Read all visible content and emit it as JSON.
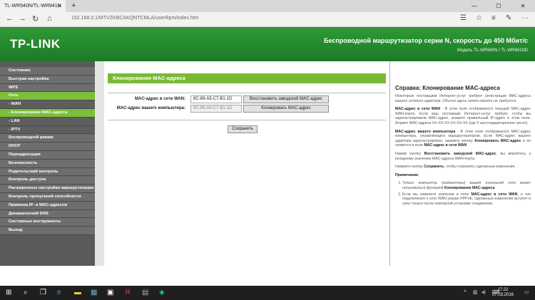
{
  "browser": {
    "tab_title": "TL-WR940N/TL-WR941N",
    "tab_close": "✕",
    "new_tab": "+",
    "url": "192.168.0.1/MTVZKBCAKQNTCMLA/userRpm/index.htm",
    "window_controls": [
      "—",
      "☐",
      "✕"
    ]
  },
  "router": {
    "logo": "TP-LINK",
    "title": "Беспроводной маршрутизатор серии N, скорость до 450 Мбит/с",
    "model": "Модель TL-WR940N / TL-WR941ND"
  },
  "menu": [
    {
      "label": "Состояние"
    },
    {
      "label": "Быстрая настройка"
    },
    {
      "label": "WPS"
    },
    {
      "label": "Сеть",
      "active": true
    },
    {
      "label": "- WAN",
      "sub": true
    },
    {
      "label": "- Клонирование MAC-адреса",
      "sub": true
    },
    {
      "label": "- LAN",
      "sub": true
    },
    {
      "label": "- IPTV",
      "sub": true
    },
    {
      "label": "Беспроводной режим"
    },
    {
      "label": "DHCP"
    },
    {
      "label": "Переадресация"
    },
    {
      "label": "Безопасность"
    },
    {
      "label": "Родительский контроль"
    },
    {
      "label": "Контроль доступа"
    },
    {
      "label": "Расширенные настройки маршрутизации"
    },
    {
      "label": "Контроль пропускной способности"
    },
    {
      "label": "Привязка IP- и MAC-адресов"
    },
    {
      "label": "Динамический DNS"
    },
    {
      "label": "Системные инструменты"
    },
    {
      "label": "Выход"
    }
  ],
  "main": {
    "section_title": "Клонирование MAC-адреса",
    "wan_mac_label": "MAC-адрес в сети WAN:",
    "wan_mac_value": "8C-89-A5-C7-B1-1D",
    "restore_button": "Восстановить заводской MAC-адрес",
    "pc_mac_label": "MAC-адрес вашего компьютера:",
    "pc_mac_value": "8C-89-A5-C7-B1-1D",
    "clone_button": "Клонировать MAC-адрес",
    "save_button": "Сохранить"
  },
  "help": {
    "title": "Справка: Клонирование MAC-адреса",
    "p1": "Некоторые поставщики Интернет-услуг требуют регистрации MAC-адреса вашего сетевого адаптера. Обычно здесь ничего менять не требуется.",
    "p2_bold": "MAC-адрес в сети WAN",
    "p2": " - В этом поле отображается текущий MAC-адрес WAN-порта. Если ваш поставщик Интернет-услуг требует, чтобы вы зарегистрировали MAC-адрес, укажите правильный IP-адрес в этом поле. Формат MAC-адреса XX-XX-XX-XX-XX-XX (где X шестнадцатеричное число).",
    "p3_bold": "MAC-адрес вашего компьютера",
    "p3": " - В этом поле отображается MAC-адрес компьютера, управляющего маршрутизатором. Если MAC-адрес вашего адаптера зарегистрирован, нажмите кнопку ",
    "p3_bold2": "Клонировать MAC-адрес",
    "p3_mid": " и он появится в поле ",
    "p3_bold3": "MAC-адрес в сети WAN",
    "p4_pre": "Нажав кнопку ",
    "p4_bold": "Восстановить заводской MAC-адрес",
    "p4": ", вы вернётесь к исходному значению MAC-адреса WAN-порта.",
    "p5_pre": "Нажмите кнопку ",
    "p5_bold": "Сохранить",
    "p5": ", чтобы сохранить сделанные изменения.",
    "note_title": "Примечание:",
    "note1_pre": "Только компьютер (компьютеры) вашей локальной сети может пользоваться функцией ",
    "note1_bold": "Клонирования MAC-адреса",
    "note2_pre": "Если вы измените значение в поле ",
    "note2_bold": "MAC-адрес в сети WAN",
    "note2": ", и тип подключения к сети WAN указан PPPoE, сделанные изменения вступят в силу только после повторной установки соединения."
  },
  "taskbar": {
    "time": "17:22",
    "date": "07.03.2016"
  }
}
